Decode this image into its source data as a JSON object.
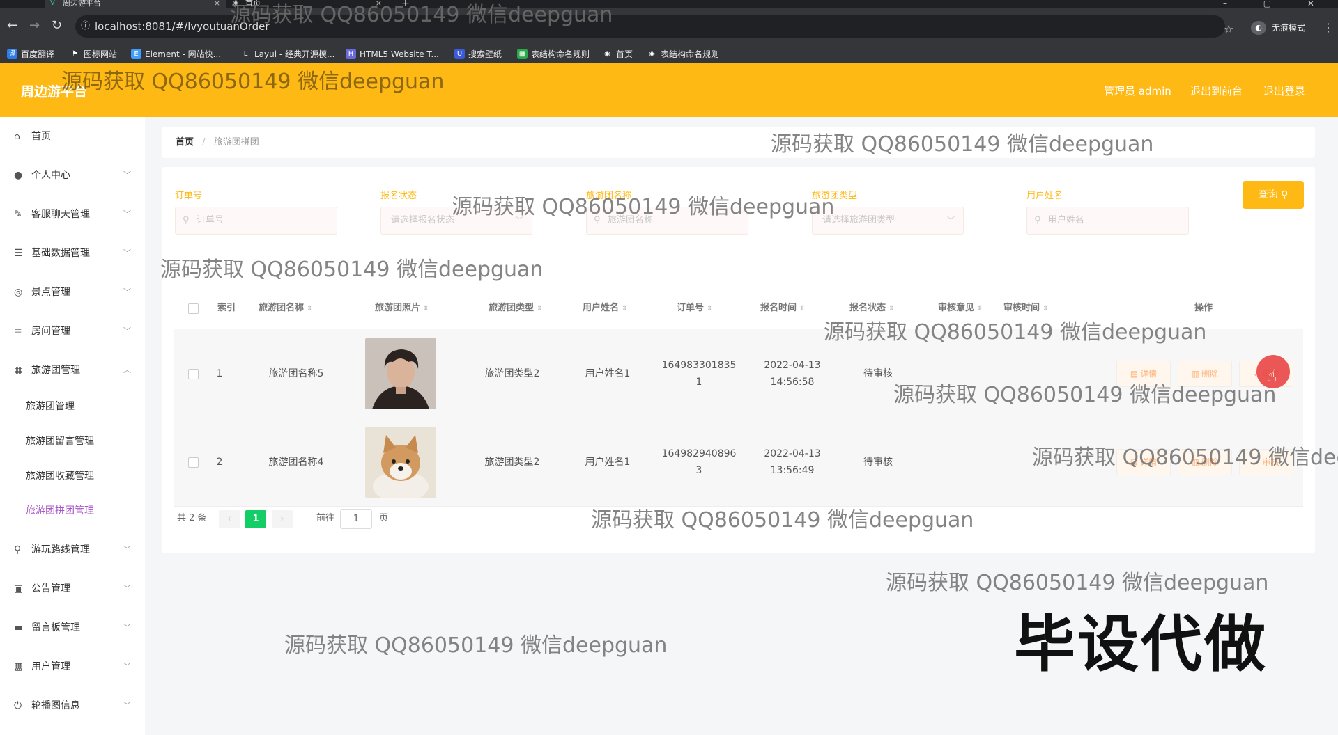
{
  "browser": {
    "tabs": [
      {
        "title": "周边游平台",
        "close": "×"
      },
      {
        "title": "首页",
        "close": "×"
      }
    ],
    "new_tab": "+",
    "url": "localhost:8081/#/lvyoutuanOrder",
    "incognito_label": "无痕模式",
    "bookmarks": [
      "百度翻译",
      "图标网站",
      "Element - 网站快...",
      "Layui - 经典开源模...",
      "HTML5 Website T...",
      "搜索壁纸",
      "表结构命名规则",
      "首页",
      "表结构命名规则"
    ]
  },
  "header": {
    "app_title": "周边游平台",
    "admin_label": "管理员 admin",
    "back_label": "退出到前台",
    "logout_label": "退出登录"
  },
  "sidebar": {
    "items": [
      {
        "label": "首页",
        "icon": "home-icon"
      },
      {
        "label": "个人中心",
        "icon": "user-icon"
      },
      {
        "label": "客服聊天管理",
        "icon": "edit-icon"
      },
      {
        "label": "基础数据管理",
        "icon": "list-icon"
      },
      {
        "label": "景点管理",
        "icon": "compass-icon"
      },
      {
        "label": "房间管理",
        "icon": "sliders-icon"
      },
      {
        "label": "旅游团管理",
        "icon": "grid-icon"
      },
      {
        "label": "游玩路线管理",
        "icon": "pin-icon"
      },
      {
        "label": "公告管理",
        "icon": "notice-icon"
      },
      {
        "label": "留言板管理",
        "icon": "monitor-icon"
      },
      {
        "label": "用户管理",
        "icon": "chart-icon"
      },
      {
        "label": "轮播图信息",
        "icon": "power-icon"
      }
    ],
    "sub_items": [
      "旅游团管理",
      "旅游团留言管理",
      "旅游团收藏管理",
      "旅游团拼团管理"
    ]
  },
  "breadcrumb": {
    "home": "首页",
    "current": "旅游团拼团"
  },
  "filters": {
    "order_no": {
      "label": "订单号",
      "placeholder": "订单号"
    },
    "status": {
      "label": "报名状态",
      "placeholder": "请选择报名状态"
    },
    "group_name": {
      "label": "旅游团名称",
      "placeholder": "旅游团名称"
    },
    "group_type": {
      "label": "旅游团类型",
      "placeholder": "请选择旅游团类型"
    },
    "user_name": {
      "label": "用户姓名",
      "placeholder": "用户姓名"
    },
    "query_label": "查询"
  },
  "table": {
    "columns": [
      "索引",
      "旅游团名称",
      "旅游团照片",
      "旅游团类型",
      "用户姓名",
      "订单号",
      "报名时间",
      "报名状态",
      "审核意见",
      "审核时间",
      "操作"
    ],
    "rows": [
      {
        "index": "1",
        "name": "旅游团名称5",
        "type": "旅游团类型2",
        "user": "用户姓名1",
        "order_no": "1649833018351",
        "time": "2022-04-13 14:56:58",
        "status": "待审核"
      },
      {
        "index": "2",
        "name": "旅游团名称4",
        "type": "旅游团类型2",
        "user": "用户姓名1",
        "order_no": "1649829408963",
        "time": "2022-04-13 13:56:49",
        "status": "待审核"
      }
    ],
    "actions": {
      "detail": "详情",
      "delete": "删除",
      "review": "审核"
    }
  },
  "pagination": {
    "total": "共 2 条",
    "current": "1",
    "goto_prefix": "前往",
    "goto_value": "1",
    "goto_suffix": "页"
  },
  "overlay": {
    "watermark": "源码获取 QQ86050149 微信deepguan",
    "promo": "毕设代做"
  },
  "colors": {
    "accent": "#ffb915",
    "active_sub": "#a855c7",
    "pager_active": "#13ce66"
  }
}
